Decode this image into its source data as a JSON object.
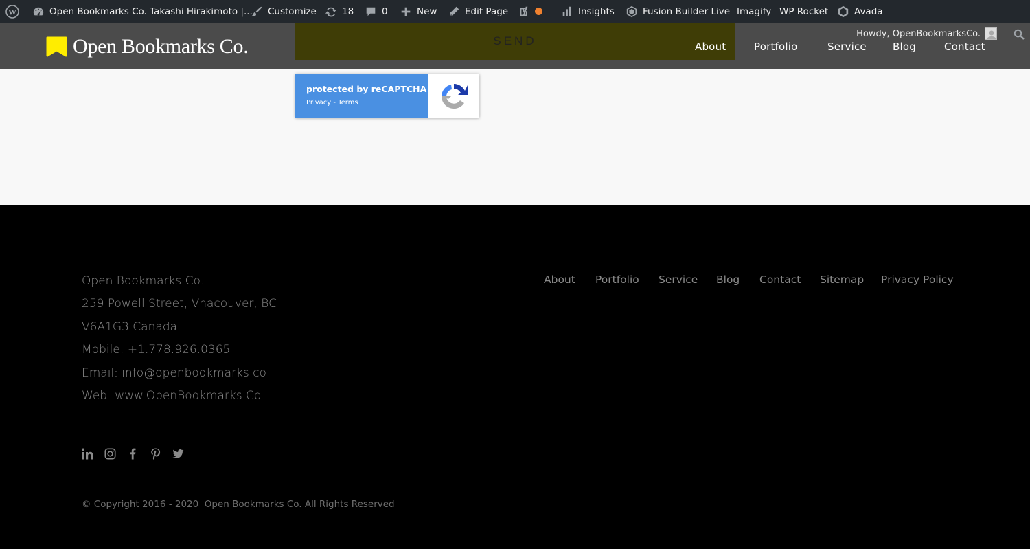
{
  "admin_bar": {
    "site_title": "Open Bookmarks Co. Takashi Hirakimoto |...",
    "customize": "Customize",
    "updates_count": "18",
    "comments_count": "0",
    "new": "New",
    "edit_page": "Edit Page",
    "insights": "Insights",
    "fusion_builder": "Fusion Builder Live",
    "imagify": "Imagify",
    "wp_rocket": "WP Rocket",
    "avada": "Avada",
    "howdy": "Howdy, OpenBookmarksCo.",
    "seo_status_color": "#f0812f"
  },
  "header": {
    "logo_text": "Open Bookmarks Co.",
    "logo_color": "#ffed00",
    "send_label": "SEND",
    "nav": [
      "About",
      "Portfolio",
      "Service",
      "Blog",
      "Contact"
    ]
  },
  "recaptcha": {
    "title": "protected by reCAPTCHA",
    "privacy": "Privacy",
    "separator": " - ",
    "terms": "Terms"
  },
  "footer": {
    "contact": [
      "Open Bookmarks Co.",
      "259 Powell Street, Vnacouver, BC",
      "V6A1G3 Canada",
      "Mobile: +1.778.926.0365",
      "Email: info@openbookmarks.co",
      "Web: www.OpenBookmarks.Co"
    ],
    "nav": [
      "About",
      "Portfolio",
      "Service",
      "Blog",
      "Contact",
      "Sitemap",
      "Privacy Policy"
    ],
    "social": [
      "linkedin-icon",
      "instagram-icon",
      "facebook-icon",
      "pinterest-icon",
      "twitter-icon"
    ],
    "copyright": "© Copyright 2016 - 2020  Open Bookmarks Co. All Rights Reserved"
  }
}
